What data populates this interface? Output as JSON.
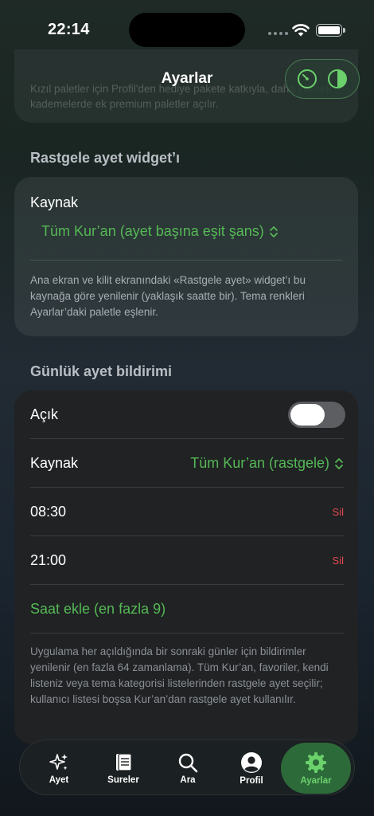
{
  "status_bar": {
    "time": "22:14"
  },
  "nav": {
    "title": "Ayarlar",
    "icons": [
      "speedometer-icon",
      "contrast-icon"
    ]
  },
  "top_card": {
    "text": "Kızıl paletler için Profil'den hediye pakete katkıyla, daha yüksek kademelerde ek premium paletler açılır."
  },
  "random_widget": {
    "header": "Rastgele ayet widget’ı",
    "source_label": "Kaynak",
    "source_value": "Tüm Kur’an (ayet başına eşit şans)",
    "footnote": "Ana ekran ve kilit ekranındaki «Rastgele ayet» widget’ı bu kaynağa göre yenilenir (yaklaşık saatte bir). Tema renkleri Ayarlar’daki paletle eşlenir."
  },
  "daily_notification": {
    "header": "Günlük ayet bildirimi",
    "enabled_label": "Açık",
    "enabled": false,
    "source_label": "Kaynak",
    "source_value": "Tüm Kur’an (rastgele)",
    "times": [
      {
        "time": "08:30",
        "delete_label": "Sil"
      },
      {
        "time": "21:00",
        "delete_label": "Sil"
      }
    ],
    "add_label": "Saat ekle (en fazla 9)",
    "footnote": "Uygulama her açıldığında bir sonraki günler için bildirimler yenilenir (en fazla 64 zamanlama). Tüm Kur’an, favoriler, kendi listeniz veya tema kategorisi listelerinden rastgele ayet seçilir; kullanıcı listesi boşsa Kur’an’dan rastgele ayet kullanılır."
  },
  "tab_bar": {
    "active": "Ayarlar",
    "tabs": [
      {
        "label": "Ayet",
        "icon": "sparkles-icon"
      },
      {
        "label": "Sureler",
        "icon": "book-icon"
      },
      {
        "label": "Ara",
        "icon": "magnifier-icon"
      },
      {
        "label": "Profil",
        "icon": "person-icon"
      },
      {
        "label": "Ayarlar",
        "icon": "gear-icon"
      }
    ]
  },
  "colors": {
    "accent": "#55b955",
    "destructive": "#e5484d",
    "active_tab_bg": "#2d6a3a"
  }
}
